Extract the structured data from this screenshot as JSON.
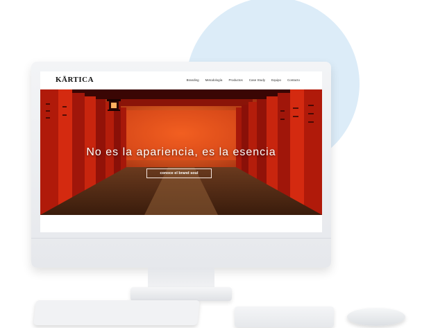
{
  "site": {
    "logo": "KĀRTICA",
    "nav": [
      "Branding",
      "Metodología",
      "Productos",
      "Case Study",
      "Equipo",
      "Contacto"
    ],
    "hero_title": "No es la apariencia, es la esencia",
    "cta_label": "conoce el brand soul"
  },
  "colors": {
    "accent_red": "#c8250e",
    "circle_blue": "#dcecf8",
    "device_gray": "#eceef1"
  },
  "icons": {
    "lantern": "lantern-icon"
  }
}
